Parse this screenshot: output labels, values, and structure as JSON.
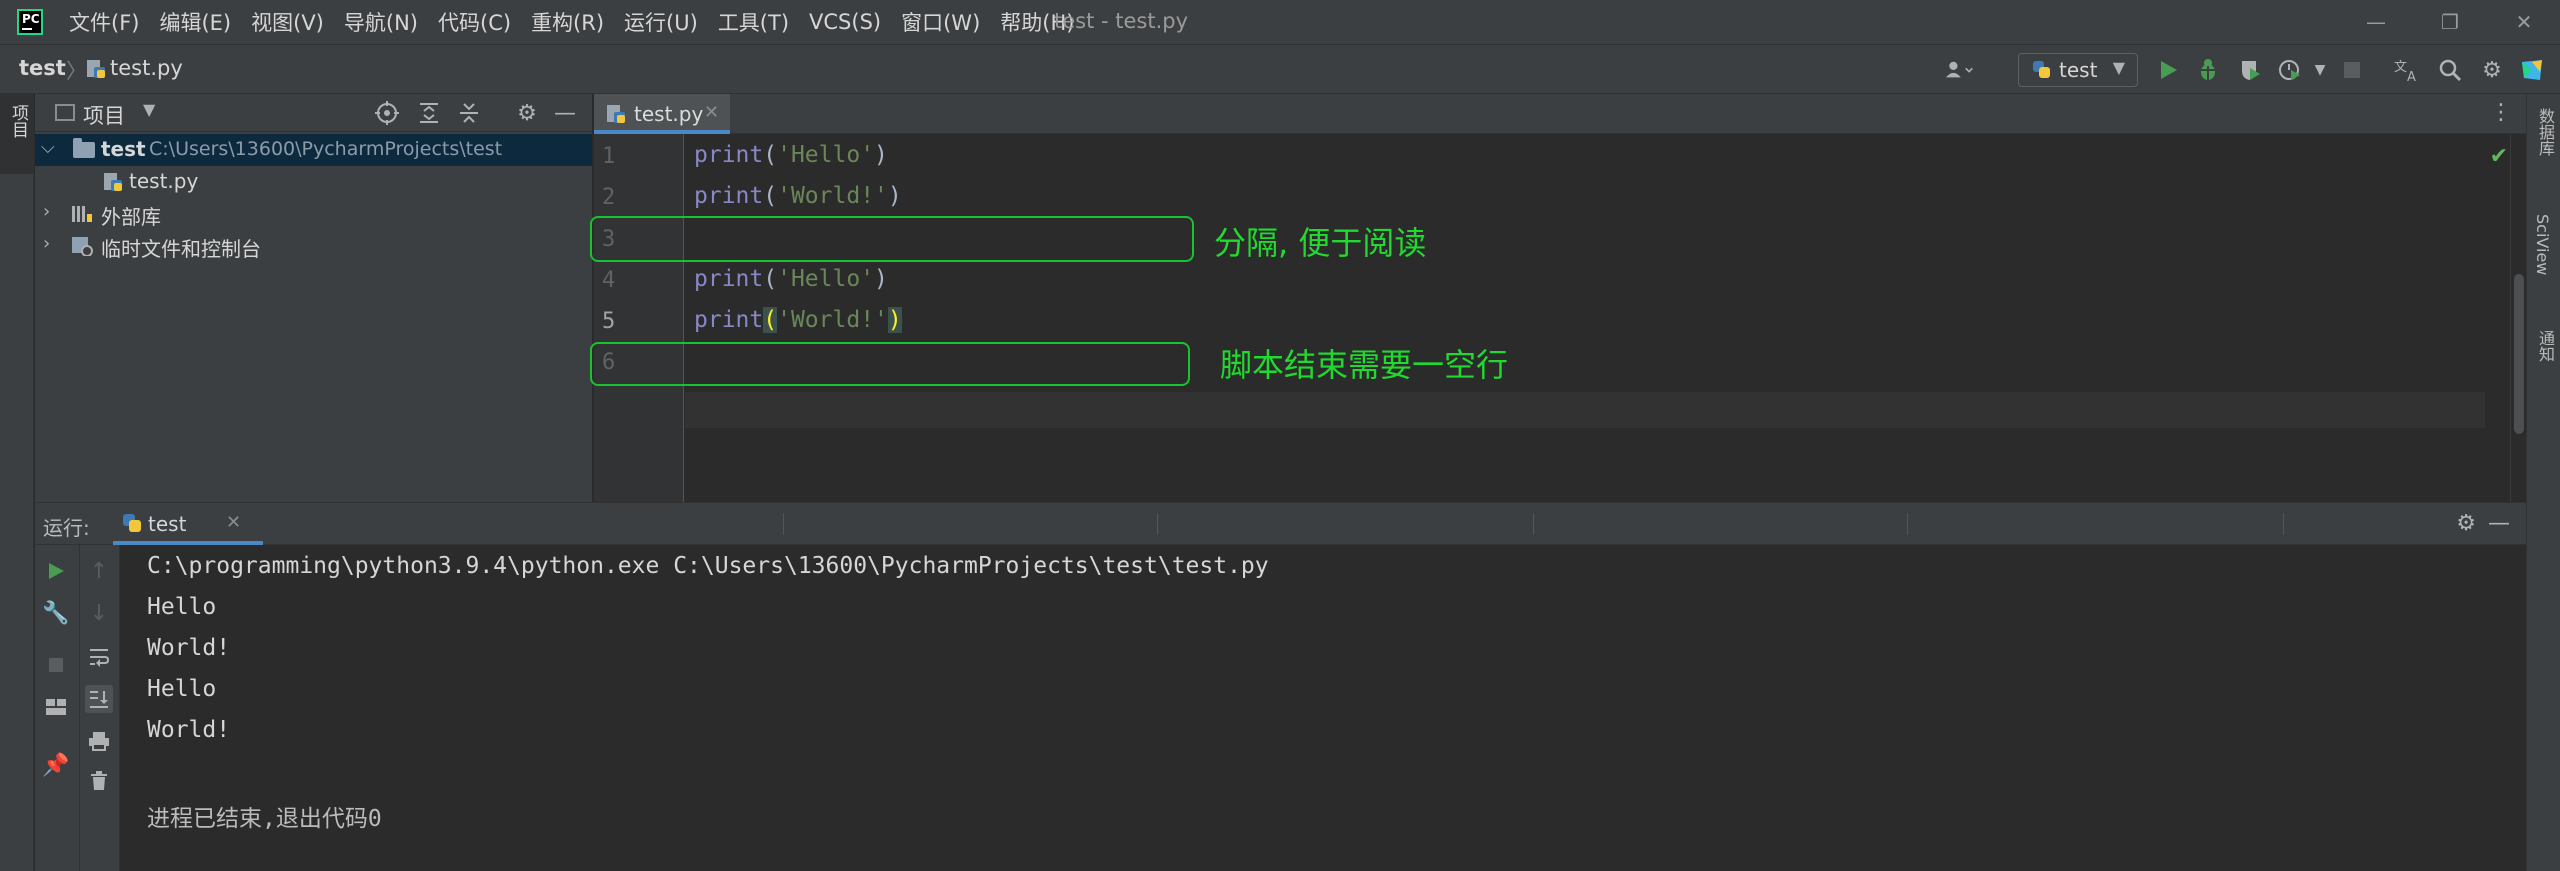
{
  "app": {
    "window_title": "test - test.py",
    "menu": [
      "文件(F)",
      "编辑(E)",
      "视图(V)",
      "导航(N)",
      "代码(C)",
      "重构(R)",
      "运行(U)",
      "工具(T)",
      "VCS(S)",
      "窗口(W)",
      "帮助(H)"
    ]
  },
  "navbar": {
    "project": "test",
    "separator": "〉",
    "file": "test.py",
    "run_config": "test"
  },
  "left_stripe": {
    "project_label": "项目"
  },
  "right_stripe": {
    "database": "数据库",
    "sciview": "SciView",
    "notifications": "通知"
  },
  "project_panel": {
    "title": "项目",
    "tree": [
      {
        "label": "test",
        "path": "C:\\Users\\13600\\PycharmProjects\\test"
      },
      {
        "label": "test.py"
      },
      {
        "label": "外部库"
      },
      {
        "label": "临时文件和控制台"
      }
    ]
  },
  "editor": {
    "tab_label": "test.py",
    "lines": [
      {
        "no": "1",
        "fn": "print",
        "open": "(",
        "arg": "'Hello'",
        "close": ")"
      },
      {
        "no": "2",
        "fn": "print",
        "open": "(",
        "arg": "'World!'",
        "close": ")"
      },
      {
        "no": "3"
      },
      {
        "no": "4",
        "fn": "print",
        "open": "(",
        "arg": "'Hello'",
        "close": ")"
      },
      {
        "no": "5",
        "fn": "print",
        "open": "(",
        "arg": "'World!'",
        "close": ")"
      },
      {
        "no": "6"
      }
    ],
    "annotations": {
      "line3": "分隔, 便于阅读",
      "line6": "脚本结束需要一空行"
    }
  },
  "run_panel": {
    "label": "运行:",
    "tab_label": "test",
    "console": [
      "C:\\programming\\python3.9.4\\python.exe C:\\Users\\13600\\PycharmProjects\\test\\test.py",
      "Hello",
      "World!",
      "Hello",
      "World!",
      "",
      "进程已结束,退出代码0"
    ]
  },
  "colors": {
    "accent_blue": "#4a88c7",
    "annotation_green": "#21d92f",
    "run_green": "#499c54"
  }
}
